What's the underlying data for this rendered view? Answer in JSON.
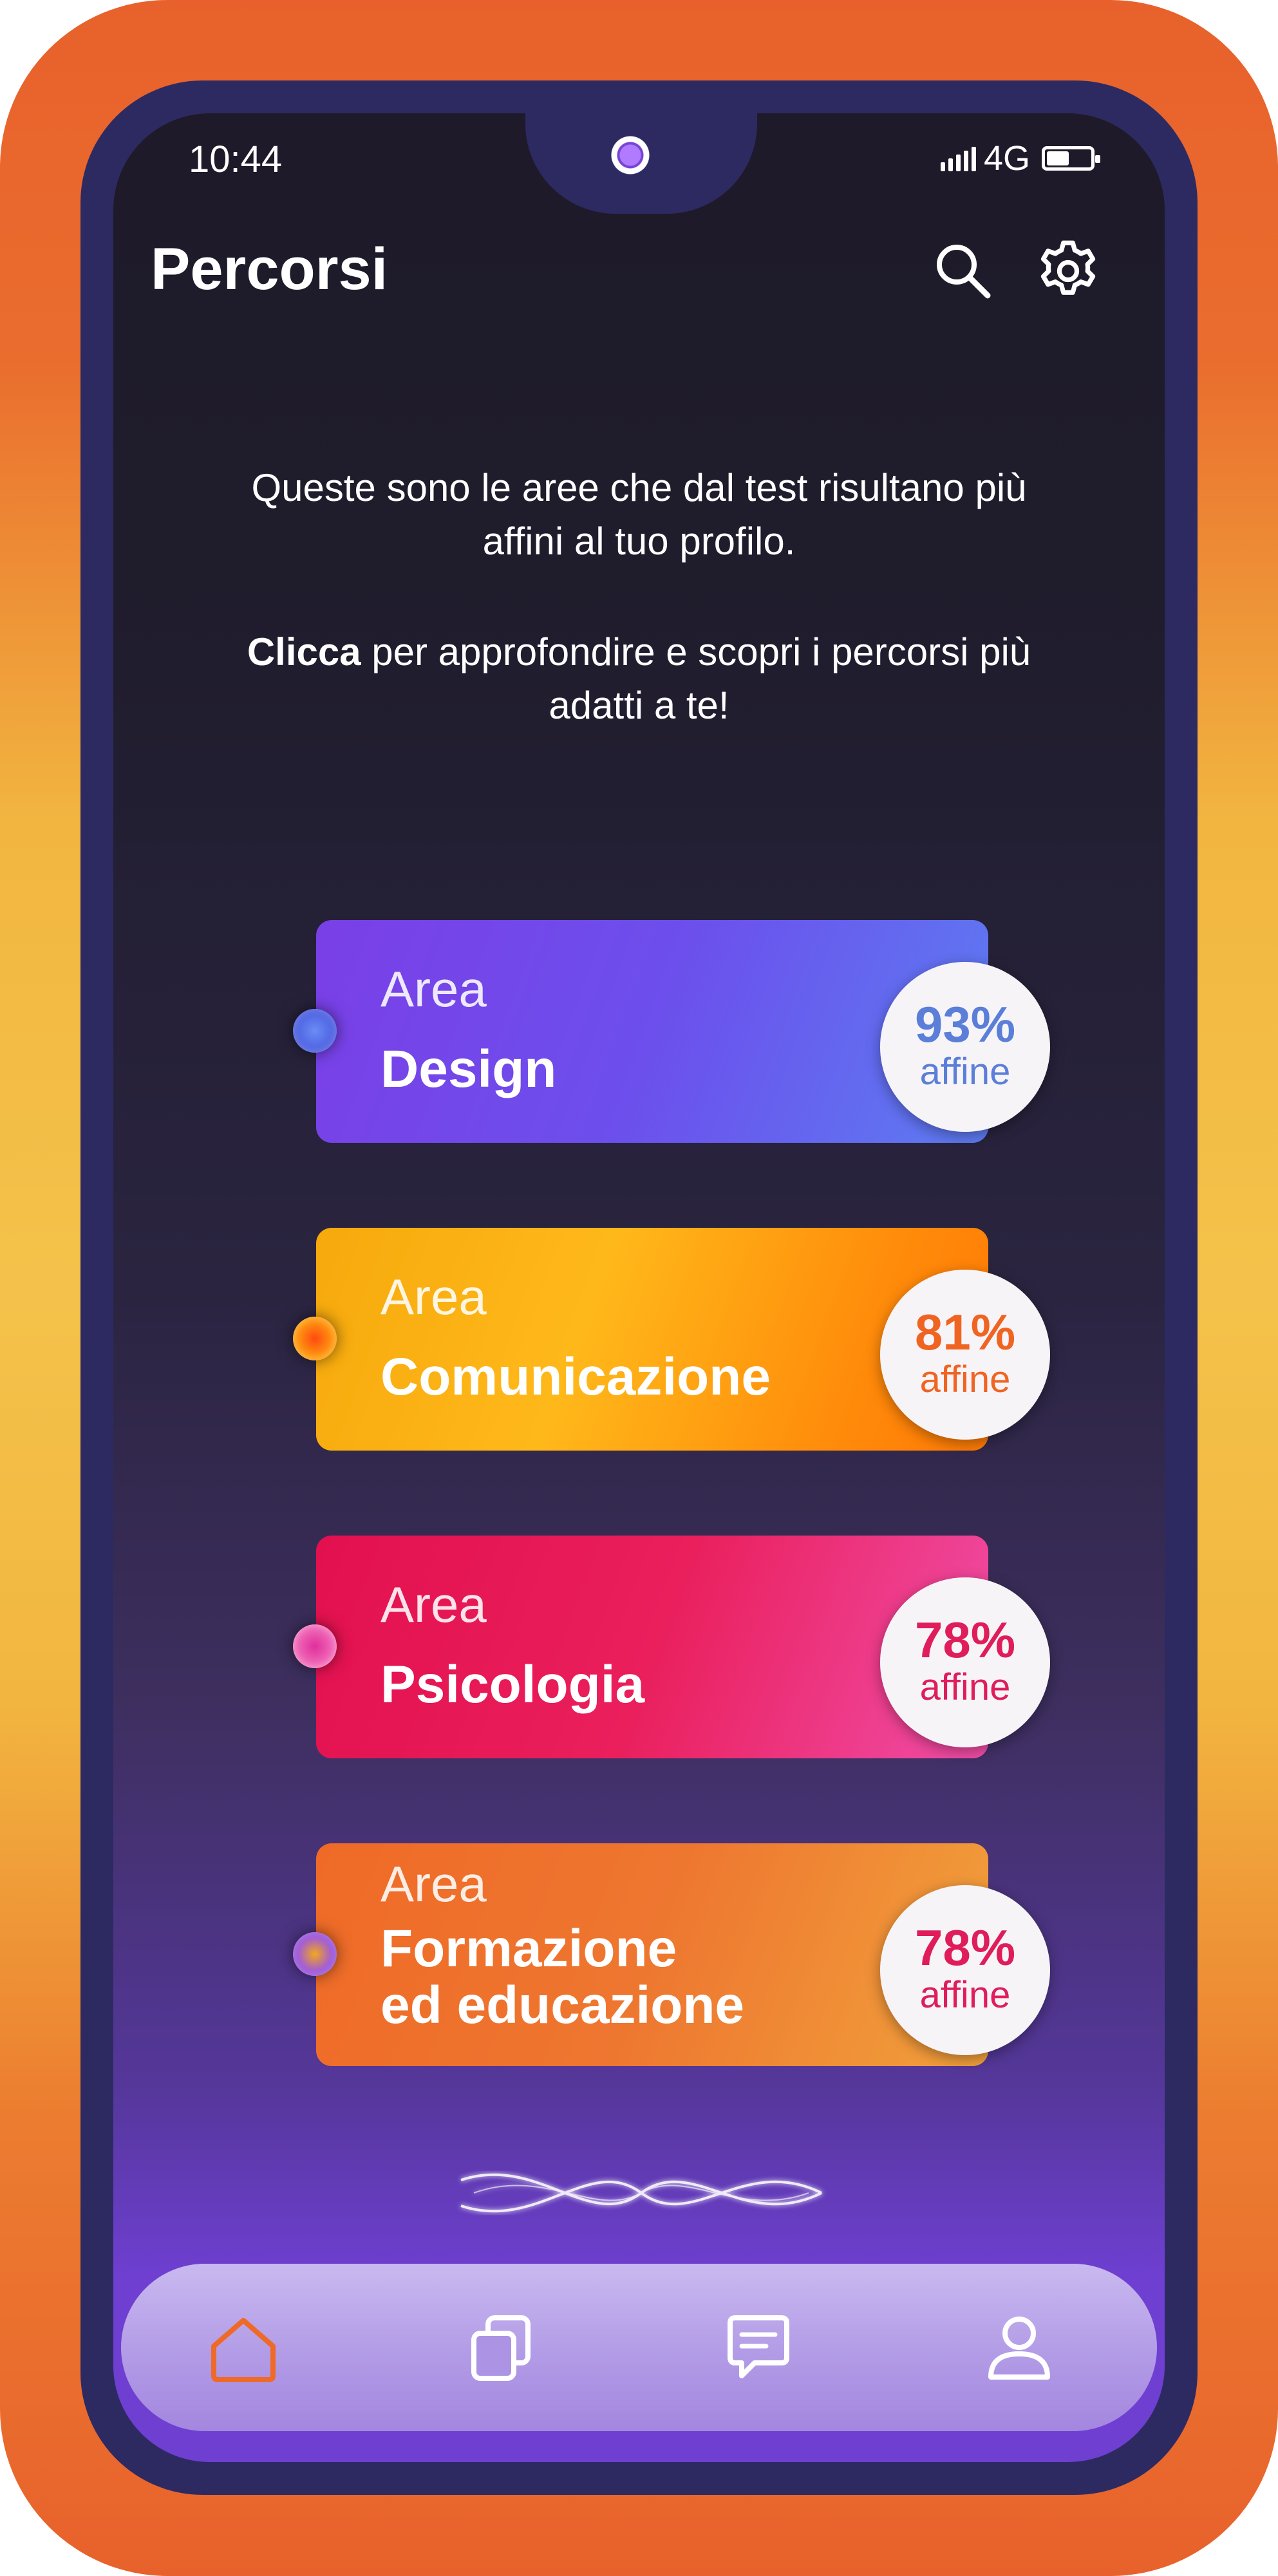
{
  "status_bar": {
    "time": "10:44",
    "network": "4G",
    "battery_level": 0.55
  },
  "header": {
    "title": "Percorsi",
    "search_icon": "search-icon",
    "settings_icon": "gear-icon"
  },
  "intro": {
    "line1": "Queste sono le aree che dal test risultano più affini al tuo profilo.",
    "cta_bold": "Clicca",
    "cta_rest": " per approfondire e scopri i percorsi più adatti a te!"
  },
  "areas": [
    {
      "label": "Area",
      "name": "Design",
      "percent": "93%",
      "affinity": "affine",
      "color": "#6c4fec"
    },
    {
      "label": "Area",
      "name": "Comunicazione",
      "percent": "81%",
      "affinity": "affine",
      "color": "#ffb81a"
    },
    {
      "label": "Area",
      "name": "Psicologia",
      "percent": "78%",
      "affinity": "affine",
      "color": "#e3104f"
    },
    {
      "label": "Area",
      "name_line1": "Formazione",
      "name_line2": "ed educazione",
      "percent": "78%",
      "affinity": "affine",
      "color": "#ef6a27"
    }
  ],
  "nav": [
    {
      "icon": "home-icon",
      "active": true,
      "color": "#ef6a27"
    },
    {
      "icon": "copy-icon",
      "active": false
    },
    {
      "icon": "chat-icon",
      "active": false
    },
    {
      "icon": "user-icon",
      "active": false
    }
  ]
}
